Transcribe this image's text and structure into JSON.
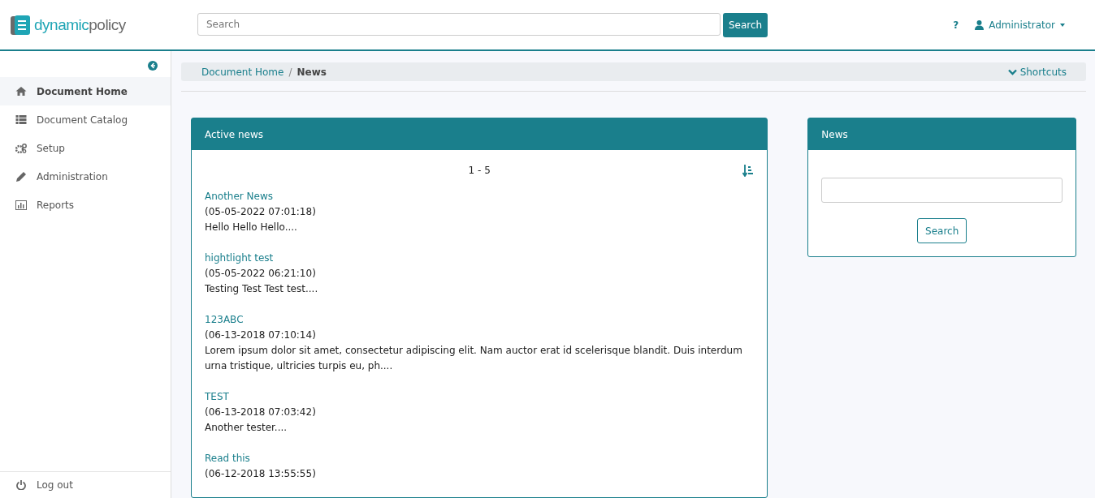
{
  "header": {
    "logo": {
      "primary": "dynamic",
      "secondary": "policy"
    },
    "search": {
      "placeholder": "Search",
      "button": "Search"
    },
    "help": "?",
    "user": "Administrator"
  },
  "sidebar": {
    "items": [
      {
        "label": "Document Home",
        "selected": true
      },
      {
        "label": "Document Catalog",
        "selected": false
      },
      {
        "label": "Setup",
        "selected": false
      },
      {
        "label": "Administration",
        "selected": false
      },
      {
        "label": "Reports",
        "selected": false
      }
    ],
    "logout": "Log out"
  },
  "breadcrumb": {
    "items": [
      "Document Home",
      "News"
    ],
    "separator": "/",
    "shortcuts": "Shortcuts"
  },
  "active_news": {
    "title": "Active news",
    "range": "1 - 5",
    "items": [
      {
        "title": "Another News",
        "date": "(05-05-2022 07:01:18)",
        "summary": "Hello Hello Hello...."
      },
      {
        "title": "hightlight test",
        "date": "(05-05-2022 06:21:10)",
        "summary": "Testing Test Test test...."
      },
      {
        "title": "123ABC",
        "date": "(06-13-2018 07:10:14)",
        "summary": "Lorem ipsum dolor sit amet, consectetur adipiscing elit. Nam auctor erat id scelerisque blandit. Duis interdum urna tristique, ultricies turpis eu, ph...."
      },
      {
        "title": "TEST",
        "date": "(06-13-2018 07:03:42)",
        "summary": "Another tester...."
      },
      {
        "title": "Read this",
        "date": "(06-12-2018 13:55:55)"
      }
    ]
  },
  "news_search": {
    "title": "News",
    "button": "Search"
  }
}
